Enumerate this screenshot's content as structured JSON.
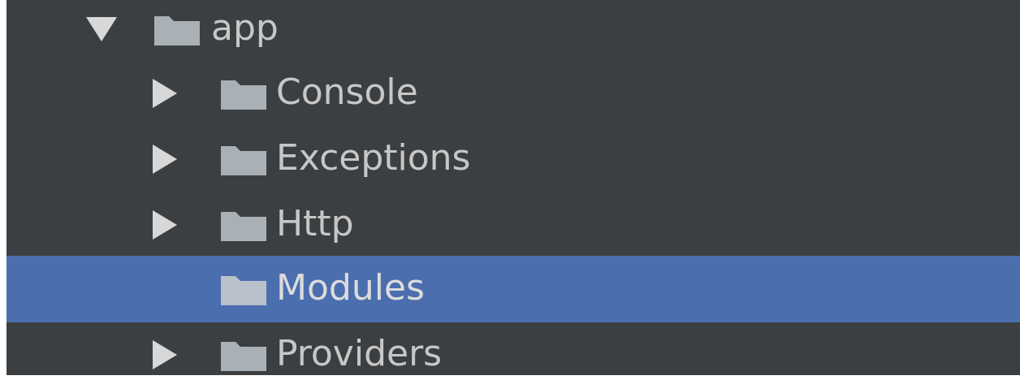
{
  "tree": {
    "root": {
      "label": "app",
      "expanded": true,
      "icon": "folder-icon"
    },
    "children": [
      {
        "label": "Console",
        "expandable": true,
        "selected": false,
        "icon": "folder-icon"
      },
      {
        "label": "Exceptions",
        "expandable": true,
        "selected": false,
        "icon": "folder-icon"
      },
      {
        "label": "Http",
        "expandable": true,
        "selected": false,
        "icon": "folder-icon"
      },
      {
        "label": "Modules",
        "expandable": false,
        "selected": true,
        "icon": "folder-icon"
      },
      {
        "label": "Providers",
        "expandable": true,
        "selected": false,
        "icon": "folder-icon"
      }
    ]
  },
  "colors": {
    "background": "#3c3f41",
    "selection": "#4b6eaf",
    "text": "#c7c7c7",
    "folder": "#a9b0b6",
    "arrow": "#d8d8d8"
  }
}
